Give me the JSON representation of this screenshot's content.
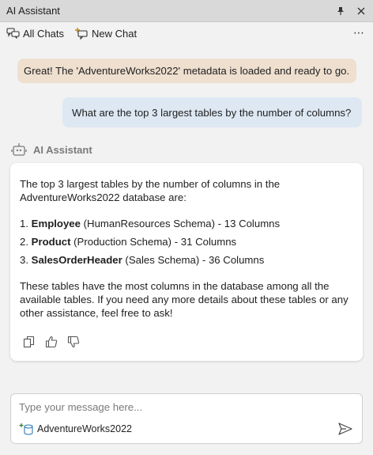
{
  "window": {
    "title": "AI Assistant"
  },
  "toolbar": {
    "all_chats_label": "All Chats",
    "new_chat_label": "New Chat",
    "more_label": "⋯"
  },
  "messages": {
    "system": "Great! The 'AdventureWorks2022' metadata is loaded and ready to go.",
    "user": "What are the top 3 largest tables by the number of columns?"
  },
  "assistant": {
    "name": "AI Assistant",
    "intro": "The top 3 largest tables by the number of columns in the AdventureWorks2022 database are:",
    "items": [
      {
        "num": "1. ",
        "name": "Employee",
        "detail": " (HumanResources Schema) - 13 Columns"
      },
      {
        "num": "2. ",
        "name": "Product",
        "detail": " (Production Schema) - 31 Columns"
      },
      {
        "num": "3. ",
        "name": "SalesOrderHeader",
        "detail": " (Sales Schema) - 36 Columns"
      }
    ],
    "outro": "These tables have the most columns in the database among all the available tables. If you need any more details about these tables or any other assistance, feel free to ask!"
  },
  "input": {
    "placeholder": "Type your message here...",
    "value": "",
    "context_label": "AdventureWorks2022"
  },
  "colors": {
    "system_bubble": "#eedfcf",
    "user_bubble": "#dde8f3",
    "titlebar": "#d9d9d9",
    "background": "#f2f2f2"
  },
  "icons": {
    "pin": "pin-icon",
    "close": "close-icon",
    "all_chats": "chats-icon",
    "new_chat": "new-chat-icon",
    "more": "more-icon",
    "assistant": "bot-icon",
    "copy": "copy-icon",
    "like": "thumbs-up-icon",
    "dislike": "thumbs-down-icon",
    "database": "database-icon",
    "send": "send-icon"
  }
}
